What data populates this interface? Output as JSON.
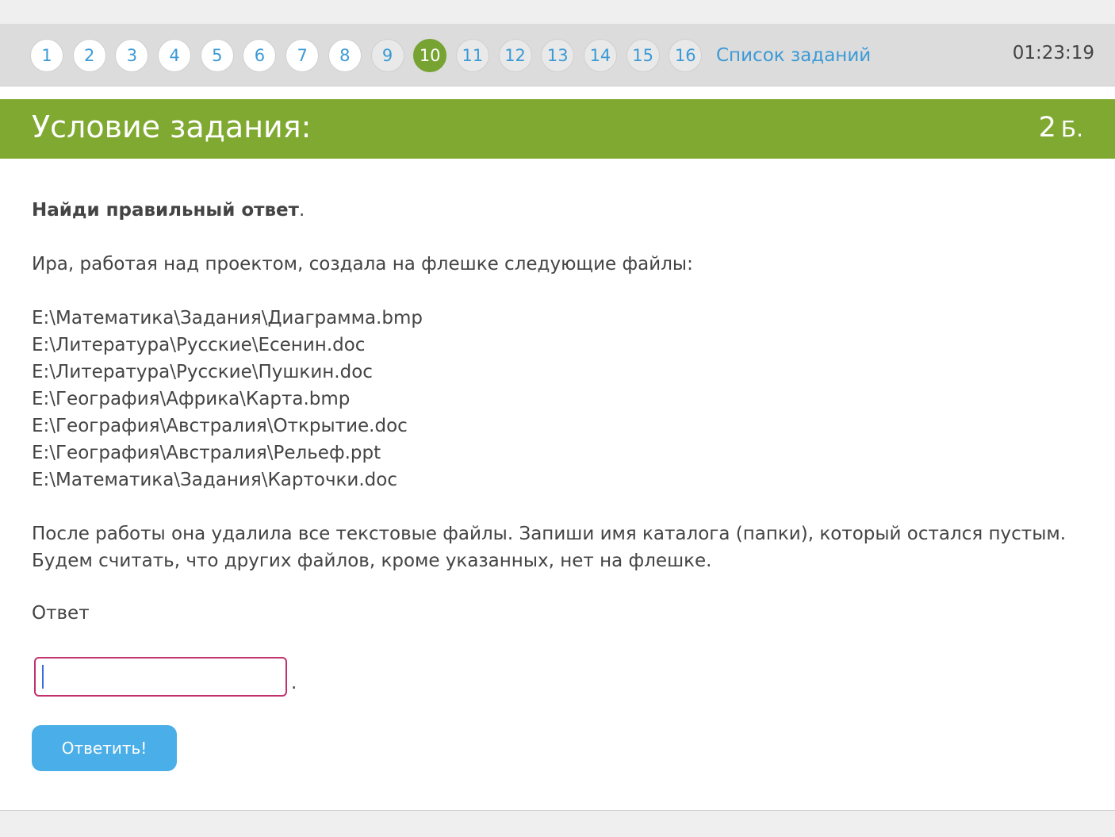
{
  "nav": {
    "items": [
      {
        "label": "1",
        "state": "done"
      },
      {
        "label": "2",
        "state": "done"
      },
      {
        "label": "3",
        "state": "done"
      },
      {
        "label": "4",
        "state": "done"
      },
      {
        "label": "5",
        "state": "done"
      },
      {
        "label": "6",
        "state": "done"
      },
      {
        "label": "7",
        "state": "done"
      },
      {
        "label": "8",
        "state": "done"
      },
      {
        "label": "9",
        "state": "todo"
      },
      {
        "label": "10",
        "state": "current"
      },
      {
        "label": "11",
        "state": "todo"
      },
      {
        "label": "12",
        "state": "todo"
      },
      {
        "label": "13",
        "state": "todo"
      },
      {
        "label": "14",
        "state": "todo"
      },
      {
        "label": "15",
        "state": "todo"
      },
      {
        "label": "16",
        "state": "todo"
      }
    ],
    "task_list_label": "Список заданий",
    "timer": "01:23:19"
  },
  "header": {
    "title": "Условие задания:",
    "points_value": "2",
    "points_unit": "Б."
  },
  "task": {
    "instruction_bold": "Найди правильный ответ",
    "instruction_end": ".",
    "intro": "Ира, работая над проектом, создала на флешке следующие файлы:",
    "files": [
      "E:\\Математика\\Задания\\Диаграмма.bmp",
      "E:\\Литература\\Русские\\Есенин.doc",
      "E:\\Литература\\Русские\\Пушкин.doc",
      "E:\\География\\Африка\\Карта.bmp",
      "E:\\География\\Австралия\\Открытие.doc",
      "E:\\География\\Австралия\\Рельеф.ppt",
      "E:\\Математика\\Задания\\Карточки.doc"
    ],
    "question": "После работы она удалила все текстовые файлы. Запиши имя каталога (папки), который остался пустым. Будем считать, что других файлов, кроме указанных, нет на флешке."
  },
  "answer": {
    "label": "Ответ",
    "value": "",
    "suffix": "."
  },
  "submit": {
    "label": "Ответить!"
  },
  "colors": {
    "accent_green": "#80a932",
    "current_task": "#76a332",
    "link_blue": "#3b9ad6",
    "button_blue": "#4aaee8",
    "input_border": "#c2306e"
  }
}
